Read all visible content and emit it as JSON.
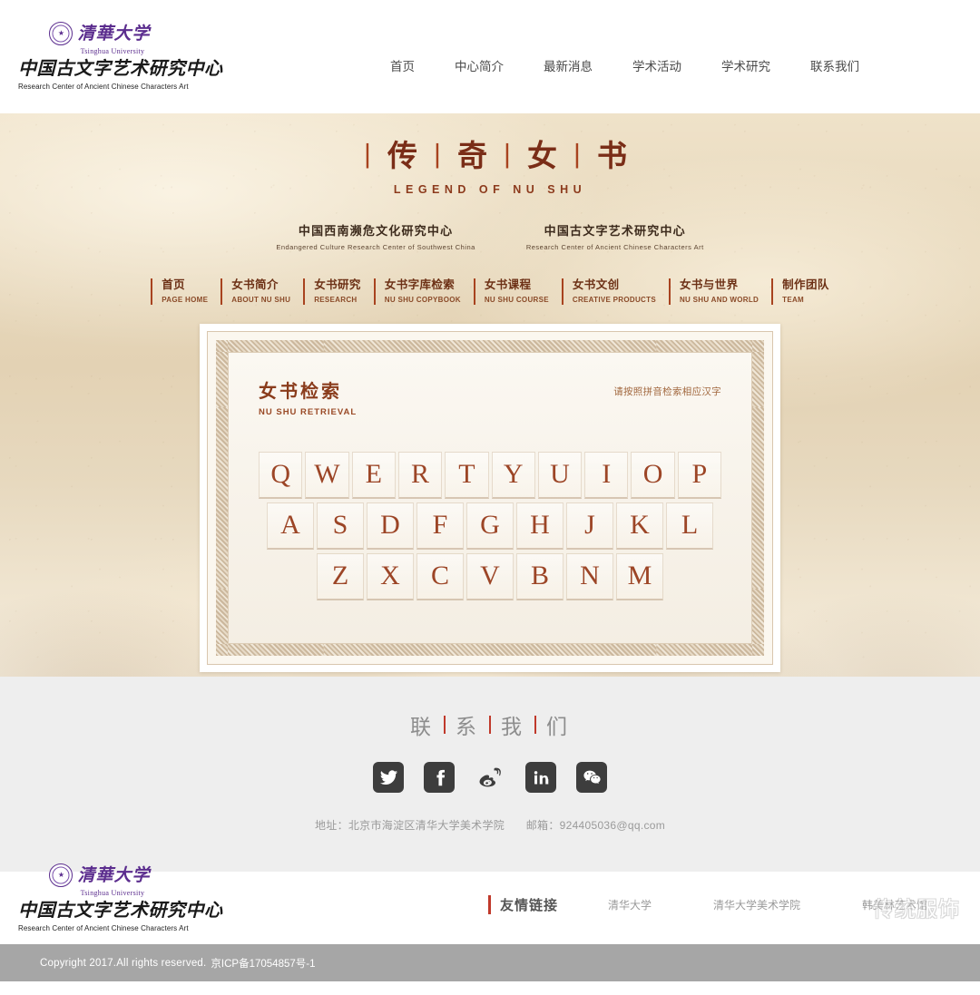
{
  "header": {
    "logo": {
      "university_cn": "清華大学",
      "university_en": "Tsinghua University",
      "center_cn": "中国古文字艺术研究中心",
      "center_en": "Research Center of Ancient Chinese Characters Art"
    },
    "nav": [
      {
        "label": "首页"
      },
      {
        "label": "中心简介"
      },
      {
        "label": "最新消息"
      },
      {
        "label": "学术活动"
      },
      {
        "label": "学术研究"
      },
      {
        "label": "联系我们"
      }
    ]
  },
  "banner": {
    "title_cn_1": "传",
    "title_cn_2": "奇",
    "title_cn_3": "女",
    "title_cn_4": "书",
    "title_en": "LEGEND OF NU SHU",
    "centers": [
      {
        "cn": "中国西南濒危文化研究中心",
        "en": "Endangered Culture Research Center of Southwest China"
      },
      {
        "cn": "中国古文字艺术研究中心",
        "en": "Research Center of Ancient Chinese Characters Art"
      }
    ],
    "sub_nav": [
      {
        "cn": "首页",
        "en": "PAGE HOME"
      },
      {
        "cn": "女书简介",
        "en": "ABOUT NU SHU"
      },
      {
        "cn": "女书研究",
        "en": "RESEARCH"
      },
      {
        "cn": "女书字库检索",
        "en": "NU SHU COPYBOOK"
      },
      {
        "cn": "女书课程",
        "en": "NU SHU COURSE"
      },
      {
        "cn": "女书文创",
        "en": "CREATIVE PRODUCTS"
      },
      {
        "cn": "女书与世界",
        "en": "NU SHU AND WORLD"
      },
      {
        "cn": "制作团队",
        "en": "TEAM"
      }
    ]
  },
  "retrieval": {
    "title_cn": "女书检索",
    "title_en": "NU SHU RETRIEVAL",
    "hint": "请按照拼音检索相应汉字",
    "keyboard_rows": [
      [
        "Q",
        "W",
        "E",
        "R",
        "T",
        "Y",
        "U",
        "I",
        "O",
        "P"
      ],
      [
        "A",
        "S",
        "D",
        "F",
        "G",
        "H",
        "J",
        "K",
        "L"
      ],
      [
        "Z",
        "X",
        "C",
        "V",
        "B",
        "N",
        "M"
      ]
    ]
  },
  "contact": {
    "title_chars": [
      "联",
      "系",
      "我",
      "们"
    ],
    "socials": [
      {
        "name": "twitter-icon"
      },
      {
        "name": "facebook-icon"
      },
      {
        "name": "weibo-icon"
      },
      {
        "name": "linkedin-icon"
      },
      {
        "name": "wechat-icon"
      }
    ],
    "address_label": "地址：北京市海淀区清华大学美术学院",
    "email_label": "邮箱：924405036@qq.com"
  },
  "footer": {
    "logo": {
      "university_cn": "清華大学",
      "university_en": "Tsinghua University",
      "center_cn": "中国古文字艺术研究中心",
      "center_en": "Research Center of Ancient Chinese Characters Art"
    },
    "friend_links_title": "友情链接",
    "friend_links": [
      {
        "label": "清华大学"
      },
      {
        "label": "清华大学美术学院"
      },
      {
        "label": "韩美林艺术馆"
      }
    ],
    "watermark_text": "传统服饰"
  },
  "copyright": {
    "text": "Copyright 2017.All rights reserved.",
    "icp": "京ICP备17054857号-1"
  },
  "colors": {
    "accent_red": "#c0392b",
    "brand_brown": "#8a3c1c",
    "nav_brown": "#6d3116",
    "purple": "#5b2d8e",
    "parchment": "#e3d2b4",
    "gray_bar": "#a6a6a6"
  }
}
